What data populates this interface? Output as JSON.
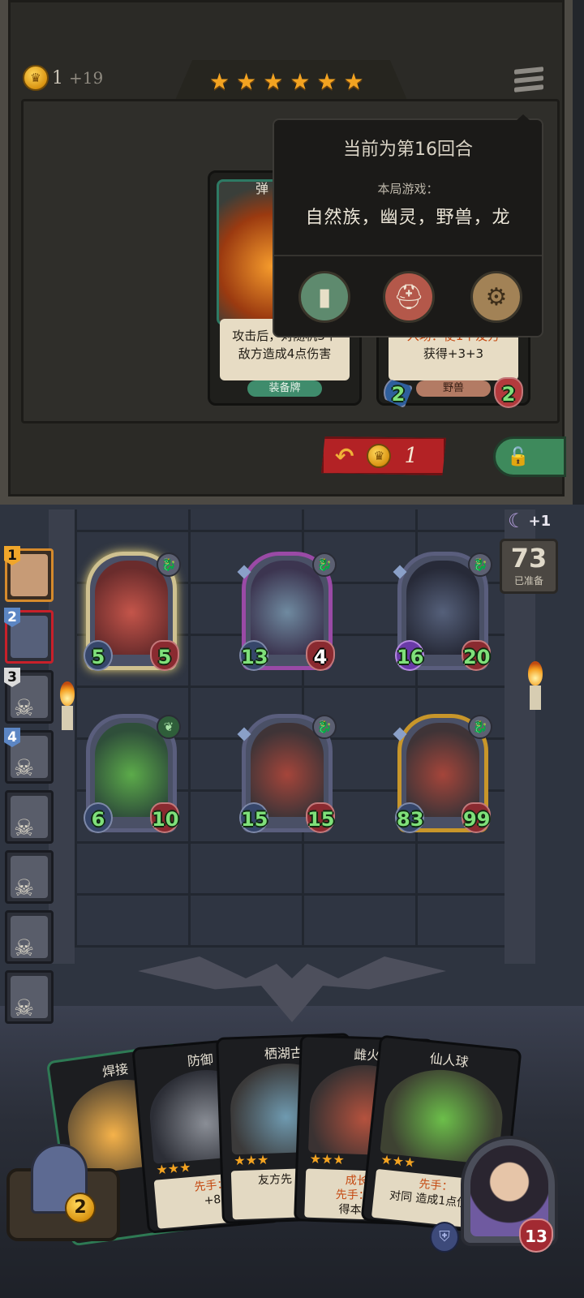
{
  "shop": {
    "gold": "1",
    "income": "+19",
    "stars": [
      "★",
      "★",
      "★",
      "★",
      "★",
      "★"
    ],
    "menu_icon": "hamburger-menu-icon",
    "refresh_cost": "1",
    "refresh_icon": "refresh-arrow-icon",
    "lock_icon": "lock-icon",
    "cards": [
      {
        "title": "弹",
        "desc_line1": "攻击后，对随机3个",
        "desc_line2": "敌方造成4点伤害",
        "tag": "装备牌"
      },
      {
        "title": "",
        "desc_line1": "入场：使1个友方",
        "desc_line2": "获得+3+3",
        "tag": "野兽",
        "attack": "2",
        "health": "2"
      }
    ]
  },
  "popup": {
    "round_text": "当前为第16回合",
    "subtitle": "本局游戏：",
    "tribes": "自然族，幽灵，野兽，龙",
    "buttons": [
      "book-icon",
      "helmet-icon",
      "gear-icon"
    ]
  },
  "board": {
    "minions": [
      {
        "attack": "5",
        "health": "5"
      },
      {
        "attack": "13",
        "health": "4"
      },
      {
        "attack": "16",
        "health": "20"
      },
      {
        "attack": "6",
        "health": "10"
      },
      {
        "attack": "15",
        "health": "15"
      },
      {
        "attack": "83",
        "health": "99"
      }
    ],
    "ready_count": "73",
    "ready_label": "已准备",
    "moon_bonus": "+1"
  },
  "leaderboard": [
    {
      "rank": "1"
    },
    {
      "rank": "2"
    },
    {
      "rank": "3"
    },
    {
      "rank": "4"
    },
    {
      "rank": ""
    },
    {
      "rank": ""
    },
    {
      "rank": ""
    },
    {
      "rank": ""
    }
  ],
  "hand": [
    {
      "title": "焊接",
      "desc": ""
    },
    {
      "title": "防御",
      "desc_key": "先手：",
      "desc": "+8"
    },
    {
      "title": "栖湖古",
      "desc": "友方先 触发"
    },
    {
      "title": "雌火",
      "desc_key": "成长：",
      "desc_key2": "先手：第1",
      "desc": "得本随从"
    },
    {
      "title": "仙人球",
      "desc_key": "先手：",
      "desc": "对同 造成1点伤害"
    }
  ],
  "hero": {
    "health": "13"
  },
  "bag": {
    "count": "2"
  }
}
